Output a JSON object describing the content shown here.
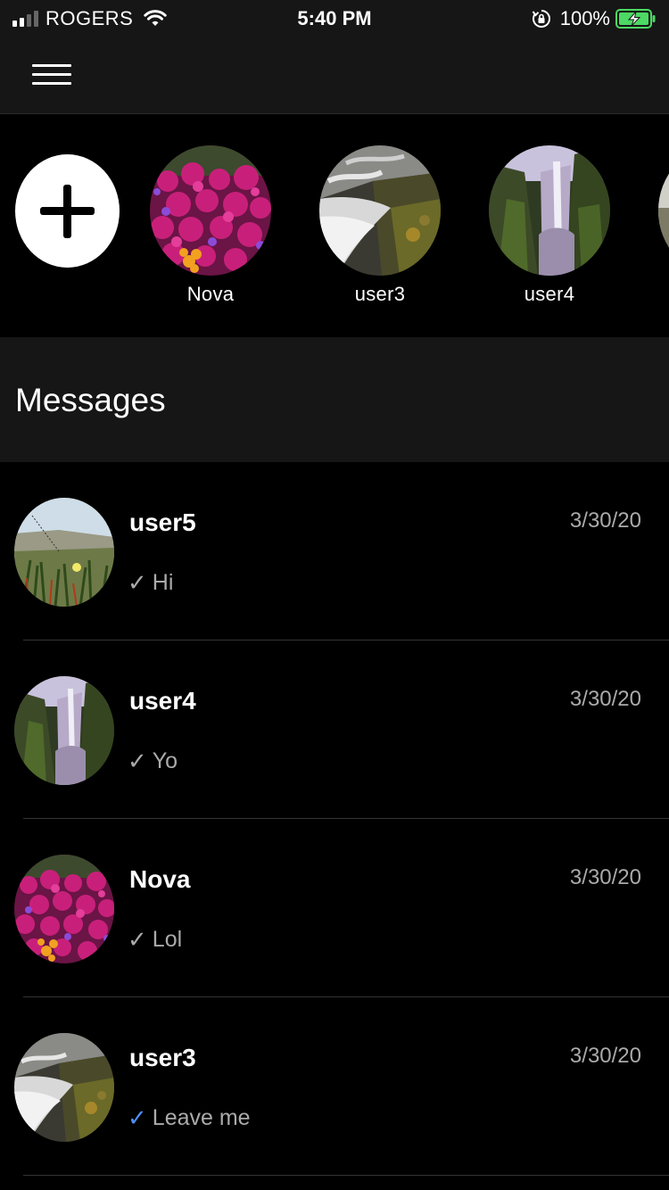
{
  "status_bar": {
    "carrier": "ROGERS",
    "time": "5:40 PM",
    "battery": "100%",
    "signal_bars": 4,
    "signal_strength": 2
  },
  "stories": {
    "items": [
      {
        "name": "Nova",
        "image": "pink-flowers"
      },
      {
        "name": "user3",
        "image": "waterfall-rapids"
      },
      {
        "name": "user4",
        "image": "tall-waterfall"
      }
    ]
  },
  "messages": {
    "title": "Messages",
    "conversations": [
      {
        "name": "user5",
        "date": "3/30/20",
        "preview": "Hi",
        "check": "✓",
        "read": false
      },
      {
        "name": "user4",
        "date": "3/30/20",
        "preview": "Yo",
        "check": "✓",
        "read": false
      },
      {
        "name": "Nova",
        "date": "3/30/20",
        "preview": "Lol",
        "check": "✓",
        "read": false
      },
      {
        "name": "user3",
        "date": "3/30/20",
        "preview": "Leave me",
        "check": "✓",
        "read": true
      }
    ]
  },
  "colors": {
    "background": "#000000",
    "bar_background": "#161616",
    "read_check": "#4f8ef7",
    "secondary_text": "#aaaaaa",
    "battery_fill": "#4cd964"
  },
  "icons": [
    "menu-icon",
    "plus-icon",
    "wifi-icon",
    "orientation-lock-icon",
    "battery-icon",
    "signal-icon",
    "check-icon"
  ]
}
